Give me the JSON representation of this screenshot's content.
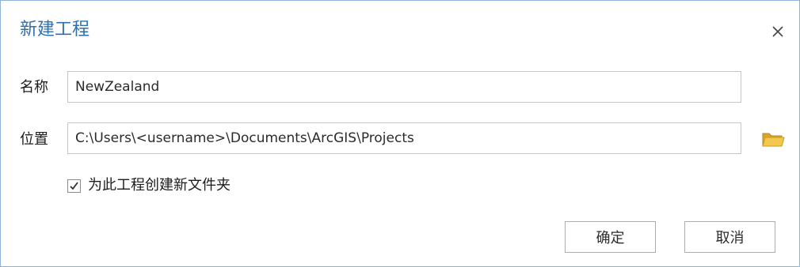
{
  "dialog": {
    "title": "新建工程",
    "close_icon": "close-icon"
  },
  "form": {
    "name_label": "名称",
    "name_value": "NewZealand",
    "location_label": "位置",
    "location_value": "C:\\Users\\<username>\\Documents\\ArcGIS\\Projects",
    "browse_icon": "folder-open-icon",
    "create_folder_label": "为此工程创建新文件夹",
    "create_folder_checked": true
  },
  "buttons": {
    "ok_label": "确定",
    "cancel_label": "取消"
  },
  "colors": {
    "title": "#2f6fae",
    "border": "#8fb3d9",
    "folder": "#e8b83a"
  }
}
